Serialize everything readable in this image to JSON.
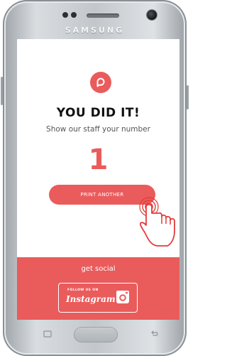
{
  "device": {
    "brand": "SAMSUNG"
  },
  "app": {
    "title": "YOU DID IT!",
    "subtitle": "Show our staff your number",
    "order_number": "1",
    "print_button_label": "PRINT ANOTHER",
    "social": {
      "heading": "get social",
      "follow_label": "FOLLOW US ON",
      "network_name": "Instagram"
    }
  },
  "colors": {
    "accent": "#ea5b5b",
    "title_text": "#111111",
    "subtitle_text": "#555555",
    "button_text": "#ffffff"
  },
  "icons": [
    "app-logo-icon",
    "tap-hand-icon",
    "instagram-icon",
    "back-key-icon",
    "recent-apps-key-icon"
  ]
}
